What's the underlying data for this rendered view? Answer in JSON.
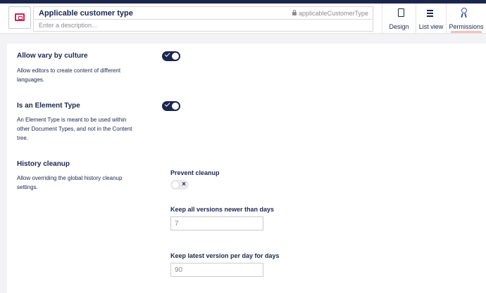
{
  "header": {
    "name_value": "Applicable customer type",
    "alias": "applicableCustomerType",
    "description_placeholder": "Enter a description...",
    "tabs": [
      {
        "label": "Design",
        "icon": "document-icon"
      },
      {
        "label": "List view",
        "icon": "list-icon"
      },
      {
        "label": "Permissions",
        "icon": "permissions-icon",
        "active": true
      }
    ]
  },
  "settings": {
    "vary_by_culture": {
      "title": "Allow vary by culture",
      "description": "Allow editors to create content of different languages.",
      "enabled": true
    },
    "element_type": {
      "title": "Is an Element Type",
      "description": "An Element Type is meant to be used within other Document Types, and not in the Content tree.",
      "enabled": true
    },
    "history_cleanup": {
      "title": "History cleanup",
      "description": "Allow overriding the global history cleanup settings.",
      "prevent_cleanup_label": "Prevent cleanup",
      "prevent_cleanup_enabled": false,
      "keep_all_label": "Keep all versions newer than days",
      "keep_all_value": "7",
      "keep_latest_label": "Keep latest version per day for days",
      "keep_latest_value": "90"
    }
  },
  "colors": {
    "primary": "#1b264f",
    "accent": "#d42054",
    "active_tab_indicator": "#f5c1bc"
  }
}
